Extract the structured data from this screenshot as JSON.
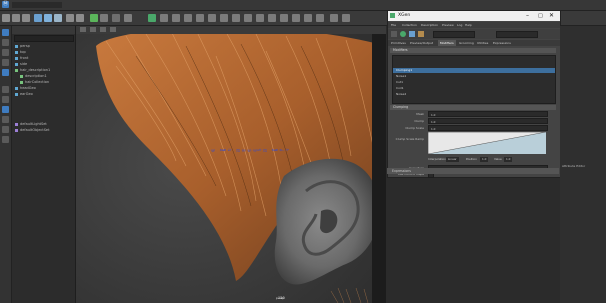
{
  "statusline": {
    "workspace_label": "Ⓜ",
    "accent": "#3f7cc0"
  },
  "outliner": {
    "items": [
      {
        "label": "persp"
      },
      {
        "label": "top"
      },
      {
        "label": "front"
      },
      {
        "label": "side"
      },
      {
        "label": "hair_description1"
      },
      {
        "label": "description1"
      },
      {
        "label": "hairCollection"
      },
      {
        "label": "headGeo"
      },
      {
        "label": "earGeo"
      },
      {
        "label": "defaultLightSet"
      },
      {
        "label": "defaultObjectSet"
      }
    ]
  },
  "viewport": {
    "overlay_text": "ஓ ஊஎ ஐஒஓஔஐ ஊஉஈ",
    "camera_label": "persp"
  },
  "xgen": {
    "title": "XGen",
    "menu": [
      "File",
      "Collection",
      "Description",
      "Preview",
      "Log",
      "Help"
    ],
    "tabs": [
      "Primitives",
      "Preview/Output",
      "Modifiers",
      "Grooming",
      "Utilities",
      "Expressions"
    ],
    "active_tab": "Modifiers",
    "modifiers_section": "Modifiers",
    "modifier_list": [
      "Clumping1",
      "Noise1",
      "Cut1",
      "Coil1",
      "Noise2"
    ],
    "selected_modifier": "Clumping1",
    "props_section": "Clumping",
    "fields": [
      {
        "label": "Mask",
        "value": "1.0"
      },
      {
        "label": "Clump",
        "value": "1.0"
      },
      {
        "label": "Clump Scale",
        "value": "1.0"
      },
      {
        "label": "Clump Scale Ramp",
        "value": ""
      }
    ],
    "ramp_controls": [
      "Interpolation",
      "Linear",
      "Position",
      "1.0",
      "Value",
      "1.0"
    ],
    "extra_fields": [
      {
        "label": "Curvature",
        "value": "0.0"
      },
      {
        "label": "Use Control Maps",
        "value": ""
      }
    ],
    "footer_section": "Expressions",
    "ramp_color": "#b9cfd9"
  },
  "right_panel": {
    "label": "Attribute Editor"
  },
  "status": {
    "frame": "120"
  }
}
